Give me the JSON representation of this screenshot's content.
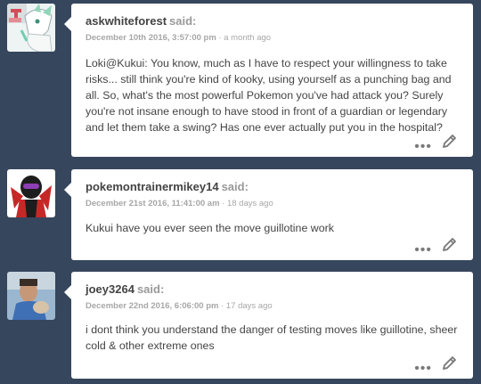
{
  "comments": [
    {
      "username": "askwhiteforest",
      "said": "said:",
      "date": "December 10th 2016, 3:57:00 pm",
      "relative": "· a month ago",
      "text": "Loki@Kukui: You know, much as I have to respect your willingness to take risks... still think you're kind of kooky, using yourself as a punching bag and all. So, what's the most powerful Pokemon you've had attack you? Surely you're not insane enough to have stood in front of a guardian or legendary and let them take a swing? Has one ever actually put you in the hospital?",
      "avatar": "white-creature-avatar",
      "more_icon": "more-dots-icon",
      "edit_icon": "pencil-icon"
    },
    {
      "username": "pokemontrainermikey14",
      "said": "said:",
      "date": "December 21st 2016, 11:41:00 am",
      "relative": "· 18 days ago",
      "text": "Kukui have you ever seen the move guillotine work",
      "avatar": "dark-character-avatar",
      "more_icon": "more-dots-icon",
      "edit_icon": "pencil-icon"
    },
    {
      "username": "joey3264",
      "said": "said:",
      "date": "December 22nd 2016, 6:06:00 pm",
      "relative": "· 17 days ago",
      "text": "i dont think you understand the danger of testing moves like guillotine, sheer cold & other extreme ones",
      "avatar": "photo-avatar",
      "more_icon": "more-dots-icon",
      "edit_icon": "pencil-icon"
    }
  ],
  "colors": {
    "background": "#36465d",
    "card": "#ffffff",
    "text": "#444444",
    "muted": "#a7a7a7"
  }
}
